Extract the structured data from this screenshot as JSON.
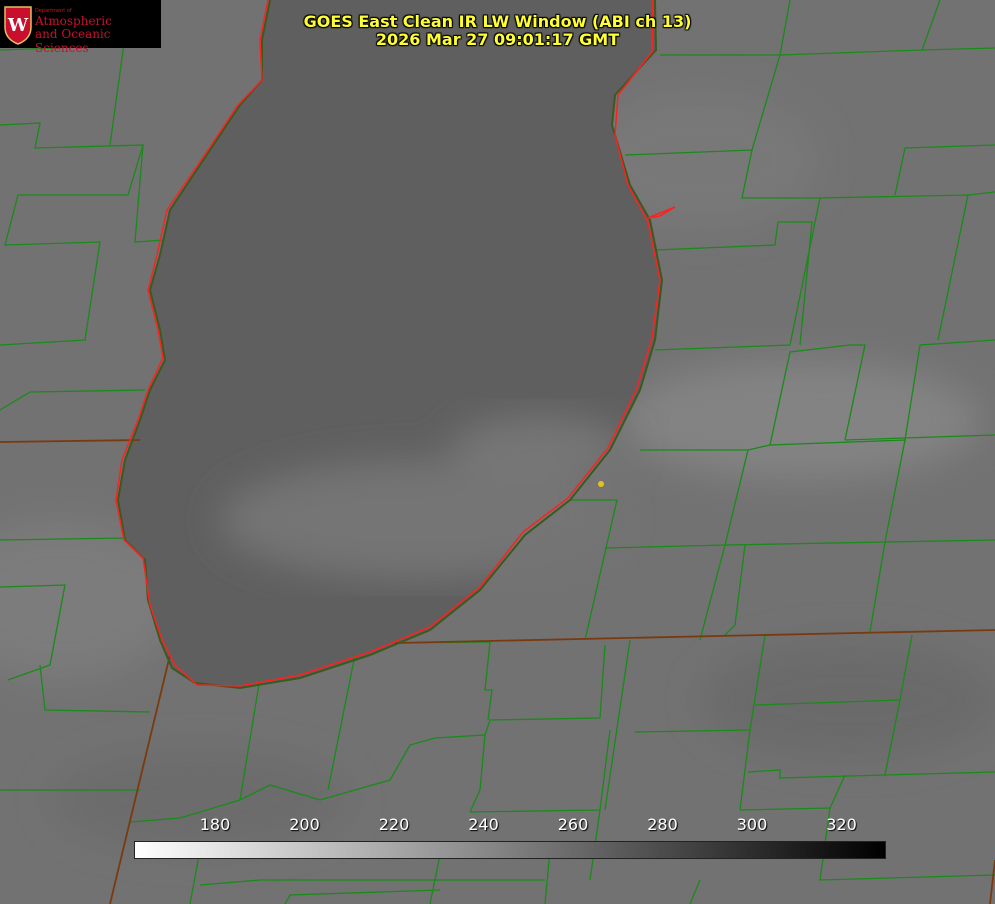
{
  "header": {
    "title": "GOES East Clean IR LW Window (ABI ch 13)",
    "timestamp": "2026 Mar 27 09:01:17 GMT"
  },
  "logo": {
    "dept": "Department of",
    "line1": "Atmospheric",
    "line2": "and Oceanic Sciences"
  },
  "colorbar": {
    "ticks": [
      "180",
      "200",
      "220",
      "240",
      "260",
      "280",
      "300",
      "320"
    ]
  },
  "colors": {
    "title": "#ffff33",
    "county_lines": "#1a8a1a",
    "coastline": "#ff2020",
    "marker": "#e8c020"
  }
}
